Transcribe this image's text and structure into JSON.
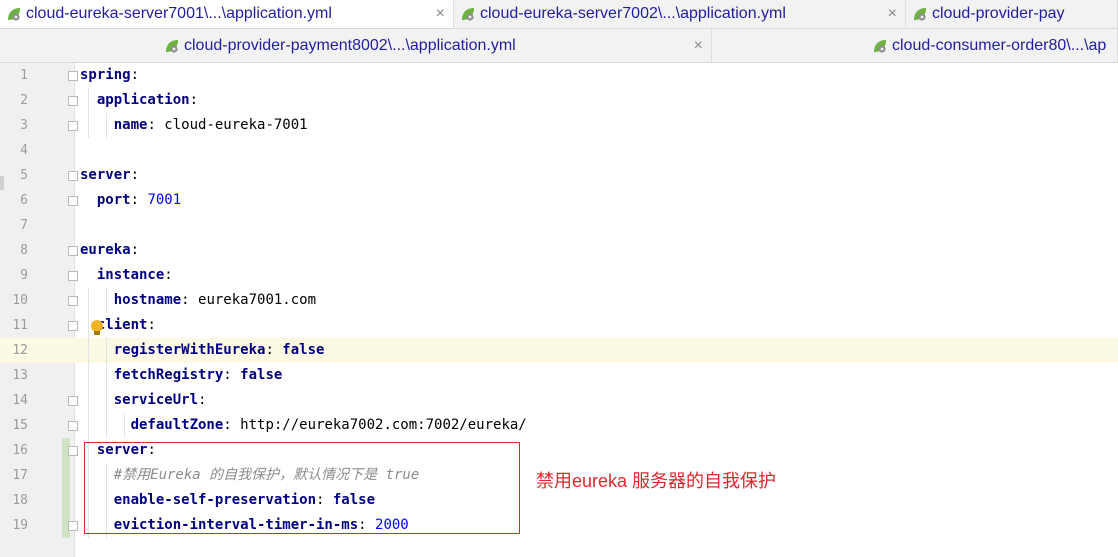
{
  "tabs_row1": [
    {
      "label": "cloud-eureka-server7001\\...\\application.yml",
      "active": true,
      "closable": true
    },
    {
      "label": "cloud-eureka-server7002\\...\\application.yml",
      "active": false,
      "closable": true
    },
    {
      "label": "cloud-provider-pay",
      "active": false,
      "closable": false
    }
  ],
  "tabs_row2": [
    {
      "label": "cloud-provider-payment8002\\...\\application.yml",
      "active": false,
      "closable": true
    },
    {
      "label": "cloud-consumer-order80\\...\\ap",
      "active": false,
      "closable": false
    }
  ],
  "close_glyph": "×",
  "tab_icon": "spring-leaf-gear-icon",
  "editor": {
    "highlighted_line": 12,
    "lines": [
      {
        "n": "1",
        "indent": "",
        "key": "spring",
        "sep": ":",
        "value": "",
        "type": "plain"
      },
      {
        "n": "2",
        "indent": "  ",
        "key": "application",
        "sep": ":",
        "value": "",
        "type": "plain"
      },
      {
        "n": "3",
        "indent": "    ",
        "key": "name",
        "sep": ": ",
        "value": "cloud-eureka-7001",
        "type": "plain"
      },
      {
        "n": "4",
        "indent": "",
        "key": "",
        "sep": "",
        "value": "",
        "type": "plain"
      },
      {
        "n": "5",
        "indent": "",
        "key": "server",
        "sep": ":",
        "value": "",
        "type": "plain"
      },
      {
        "n": "6",
        "indent": "  ",
        "key": "port",
        "sep": ": ",
        "value": "7001",
        "type": "num"
      },
      {
        "n": "7",
        "indent": "",
        "key": "",
        "sep": "",
        "value": "",
        "type": "plain"
      },
      {
        "n": "8",
        "indent": "",
        "key": "eureka",
        "sep": ":",
        "value": "",
        "type": "plain"
      },
      {
        "n": "9",
        "indent": "  ",
        "key": "instance",
        "sep": ":",
        "value": "",
        "type": "plain"
      },
      {
        "n": "10",
        "indent": "    ",
        "key": "hostname",
        "sep": ": ",
        "value": "eureka7001.com",
        "type": "plain"
      },
      {
        "n": "11",
        "indent": "  ",
        "key": "client",
        "sep": ":",
        "value": "",
        "type": "plain"
      },
      {
        "n": "12",
        "indent": "    ",
        "key": "registerWithEureka",
        "sep": ": ",
        "value": "false",
        "type": "bool"
      },
      {
        "n": "13",
        "indent": "    ",
        "key": "fetchRegistry",
        "sep": ": ",
        "value": "false",
        "type": "bool"
      },
      {
        "n": "14",
        "indent": "    ",
        "key": "serviceUrl",
        "sep": ":",
        "value": "",
        "type": "plain"
      },
      {
        "n": "15",
        "indent": "      ",
        "key": "defaultZone",
        "sep": ": ",
        "value": "http://eureka7002.com:7002/eureka/",
        "type": "plain"
      },
      {
        "n": "16",
        "indent": "  ",
        "key": "server",
        "sep": ":",
        "value": "",
        "type": "plain"
      },
      {
        "n": "17",
        "indent": "    ",
        "key": "",
        "sep": "",
        "value": "#禁用Eureka 的自我保护，默认情况下是 true",
        "type": "comment"
      },
      {
        "n": "18",
        "indent": "    ",
        "key": "enable-self-preservation",
        "sep": ": ",
        "value": "false",
        "type": "bool"
      },
      {
        "n": "19",
        "indent": "    ",
        "key": "eviction-interval-timer-in-ms",
        "sep": ": ",
        "value": "2000",
        "type": "num"
      }
    ]
  },
  "annotation": {
    "text": "禁用eureka 服务器的自我保护",
    "color": "#e0262b"
  },
  "colors": {
    "key": "#000080",
    "number": "#0000ff",
    "comment": "#8c8c8c",
    "line_highlight": "#fcf9e5",
    "tab_text": "#1f1f9e"
  }
}
